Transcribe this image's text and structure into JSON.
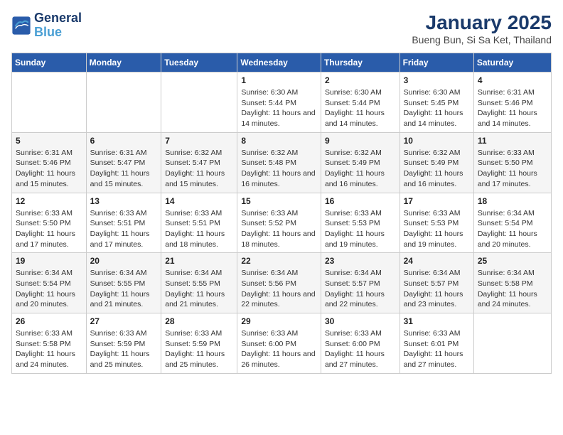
{
  "header": {
    "logo_line1": "General",
    "logo_line2": "Blue",
    "title": "January 2025",
    "subtitle": "Bueng Bun, Si Sa Ket, Thailand"
  },
  "days_of_week": [
    "Sunday",
    "Monday",
    "Tuesday",
    "Wednesday",
    "Thursday",
    "Friday",
    "Saturday"
  ],
  "weeks": [
    [
      {
        "day": "",
        "info": ""
      },
      {
        "day": "",
        "info": ""
      },
      {
        "day": "",
        "info": ""
      },
      {
        "day": "1",
        "info": "Sunrise: 6:30 AM\nSunset: 5:44 PM\nDaylight: 11 hours and 14 minutes."
      },
      {
        "day": "2",
        "info": "Sunrise: 6:30 AM\nSunset: 5:44 PM\nDaylight: 11 hours and 14 minutes."
      },
      {
        "day": "3",
        "info": "Sunrise: 6:30 AM\nSunset: 5:45 PM\nDaylight: 11 hours and 14 minutes."
      },
      {
        "day": "4",
        "info": "Sunrise: 6:31 AM\nSunset: 5:46 PM\nDaylight: 11 hours and 14 minutes."
      }
    ],
    [
      {
        "day": "5",
        "info": "Sunrise: 6:31 AM\nSunset: 5:46 PM\nDaylight: 11 hours and 15 minutes."
      },
      {
        "day": "6",
        "info": "Sunrise: 6:31 AM\nSunset: 5:47 PM\nDaylight: 11 hours and 15 minutes."
      },
      {
        "day": "7",
        "info": "Sunrise: 6:32 AM\nSunset: 5:47 PM\nDaylight: 11 hours and 15 minutes."
      },
      {
        "day": "8",
        "info": "Sunrise: 6:32 AM\nSunset: 5:48 PM\nDaylight: 11 hours and 16 minutes."
      },
      {
        "day": "9",
        "info": "Sunrise: 6:32 AM\nSunset: 5:49 PM\nDaylight: 11 hours and 16 minutes."
      },
      {
        "day": "10",
        "info": "Sunrise: 6:32 AM\nSunset: 5:49 PM\nDaylight: 11 hours and 16 minutes."
      },
      {
        "day": "11",
        "info": "Sunrise: 6:33 AM\nSunset: 5:50 PM\nDaylight: 11 hours and 17 minutes."
      }
    ],
    [
      {
        "day": "12",
        "info": "Sunrise: 6:33 AM\nSunset: 5:50 PM\nDaylight: 11 hours and 17 minutes."
      },
      {
        "day": "13",
        "info": "Sunrise: 6:33 AM\nSunset: 5:51 PM\nDaylight: 11 hours and 17 minutes."
      },
      {
        "day": "14",
        "info": "Sunrise: 6:33 AM\nSunset: 5:51 PM\nDaylight: 11 hours and 18 minutes."
      },
      {
        "day": "15",
        "info": "Sunrise: 6:33 AM\nSunset: 5:52 PM\nDaylight: 11 hours and 18 minutes."
      },
      {
        "day": "16",
        "info": "Sunrise: 6:33 AM\nSunset: 5:53 PM\nDaylight: 11 hours and 19 minutes."
      },
      {
        "day": "17",
        "info": "Sunrise: 6:33 AM\nSunset: 5:53 PM\nDaylight: 11 hours and 19 minutes."
      },
      {
        "day": "18",
        "info": "Sunrise: 6:34 AM\nSunset: 5:54 PM\nDaylight: 11 hours and 20 minutes."
      }
    ],
    [
      {
        "day": "19",
        "info": "Sunrise: 6:34 AM\nSunset: 5:54 PM\nDaylight: 11 hours and 20 minutes."
      },
      {
        "day": "20",
        "info": "Sunrise: 6:34 AM\nSunset: 5:55 PM\nDaylight: 11 hours and 21 minutes."
      },
      {
        "day": "21",
        "info": "Sunrise: 6:34 AM\nSunset: 5:55 PM\nDaylight: 11 hours and 21 minutes."
      },
      {
        "day": "22",
        "info": "Sunrise: 6:34 AM\nSunset: 5:56 PM\nDaylight: 11 hours and 22 minutes."
      },
      {
        "day": "23",
        "info": "Sunrise: 6:34 AM\nSunset: 5:57 PM\nDaylight: 11 hours and 22 minutes."
      },
      {
        "day": "24",
        "info": "Sunrise: 6:34 AM\nSunset: 5:57 PM\nDaylight: 11 hours and 23 minutes."
      },
      {
        "day": "25",
        "info": "Sunrise: 6:34 AM\nSunset: 5:58 PM\nDaylight: 11 hours and 24 minutes."
      }
    ],
    [
      {
        "day": "26",
        "info": "Sunrise: 6:33 AM\nSunset: 5:58 PM\nDaylight: 11 hours and 24 minutes."
      },
      {
        "day": "27",
        "info": "Sunrise: 6:33 AM\nSunset: 5:59 PM\nDaylight: 11 hours and 25 minutes."
      },
      {
        "day": "28",
        "info": "Sunrise: 6:33 AM\nSunset: 5:59 PM\nDaylight: 11 hours and 25 minutes."
      },
      {
        "day": "29",
        "info": "Sunrise: 6:33 AM\nSunset: 6:00 PM\nDaylight: 11 hours and 26 minutes."
      },
      {
        "day": "30",
        "info": "Sunrise: 6:33 AM\nSunset: 6:00 PM\nDaylight: 11 hours and 27 minutes."
      },
      {
        "day": "31",
        "info": "Sunrise: 6:33 AM\nSunset: 6:01 PM\nDaylight: 11 hours and 27 minutes."
      },
      {
        "day": "",
        "info": ""
      }
    ]
  ]
}
